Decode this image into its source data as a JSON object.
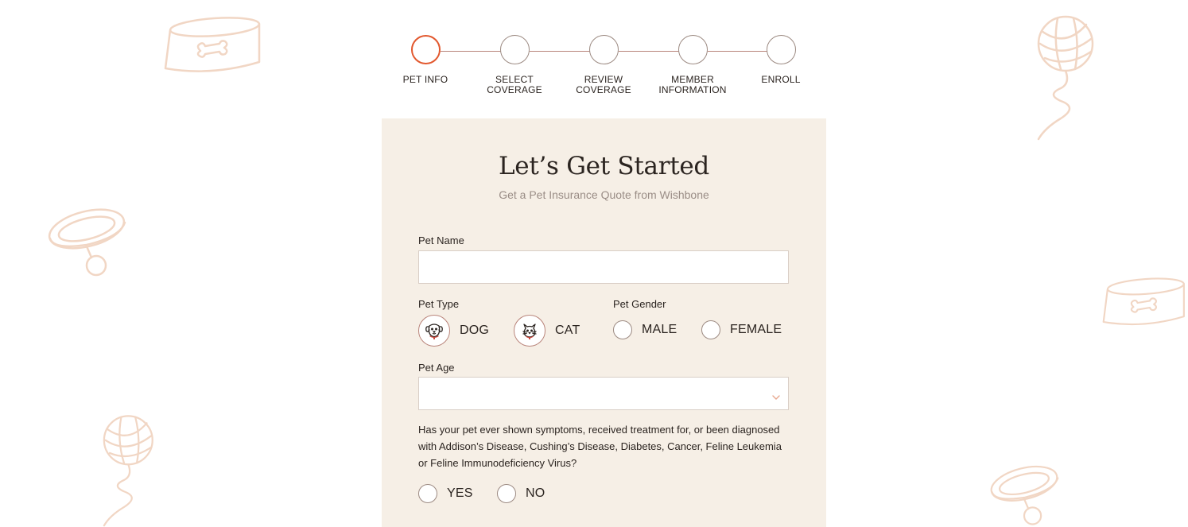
{
  "stepper": {
    "steps": [
      {
        "line1": "PET INFO",
        "line2": ""
      },
      {
        "line1": "SELECT",
        "line2": "COVERAGE"
      },
      {
        "line1": "REVIEW",
        "line2": "COVERAGE"
      },
      {
        "line1": "MEMBER",
        "line2": "INFORMATION"
      },
      {
        "line1": "ENROLL",
        "line2": ""
      }
    ],
    "active_index": 0
  },
  "form": {
    "title": "Let’s Get Started",
    "subtitle": "Get a Pet Insurance Quote from Wishbone",
    "pet_name": {
      "label": "Pet Name",
      "value": ""
    },
    "pet_type": {
      "label": "Pet Type",
      "options": [
        "DOG",
        "CAT"
      ]
    },
    "pet_gender": {
      "label": "Pet Gender",
      "options": [
        "MALE",
        "FEMALE"
      ]
    },
    "pet_age": {
      "label": "Pet Age",
      "value": ""
    },
    "health_question": {
      "text": "Has your pet ever shown symptoms, received treatment for, or been diagnosed with Addison’s Disease, Cushing’s Disease, Diabetes, Cancer, Feline Leukemia or Feline Immunodeficiency Virus?",
      "options": [
        "YES",
        "NO"
      ]
    }
  },
  "colors": {
    "accent": "#e2582e",
    "card_bg": "#f6efe6",
    "decoration": "#f1d6c4",
    "muted_text": "#9a8d86"
  },
  "icons": {
    "decorations": [
      "pet-bowl-icon",
      "yarn-ball-icon",
      "pet-collar-icon"
    ],
    "pet_type": [
      "dog-icon",
      "cat-icon"
    ],
    "select": "chevron-down-icon"
  }
}
